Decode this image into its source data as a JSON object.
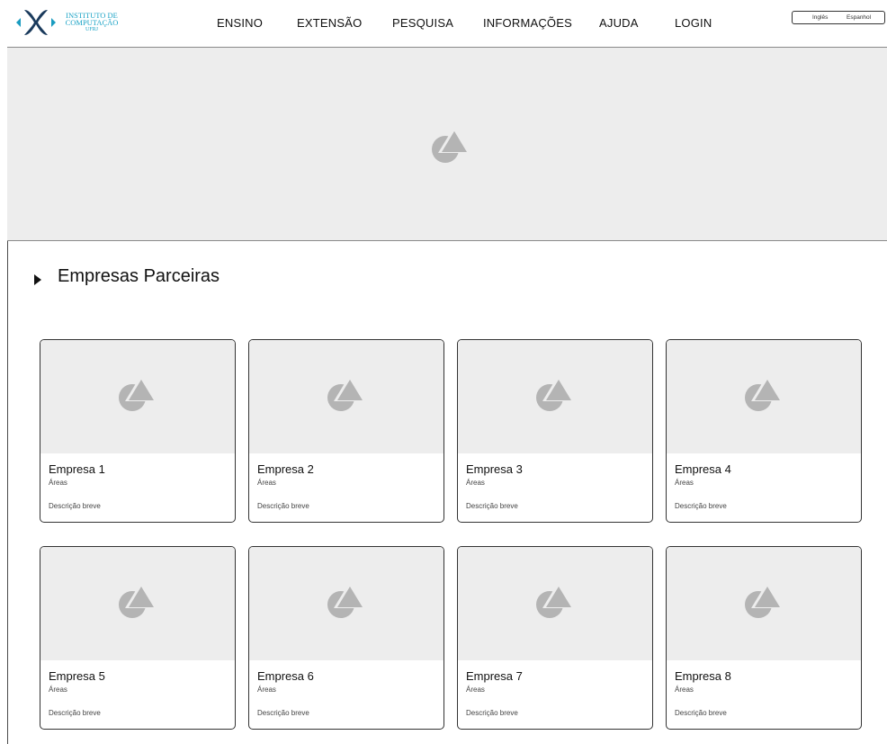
{
  "header": {
    "logo": {
      "line1": "INSTITUTO DE",
      "line2": "COMPUTAÇÃO",
      "line3": "UFRJ",
      "color": "#1ba3c6"
    },
    "nav": [
      {
        "label": "ENSINO"
      },
      {
        "label": "EXTENSÃO"
      },
      {
        "label": "PESQUISA"
      },
      {
        "label": "INFORMAÇÕES"
      },
      {
        "label": "AJUDA"
      },
      {
        "label": "LOGIN"
      }
    ],
    "lang": {
      "english": "Inglês",
      "spanish": "Espanhol"
    }
  },
  "hero": {
    "icon": "image-placeholder-icon"
  },
  "section": {
    "title": "Empresas Parceiras"
  },
  "cards": [
    {
      "name": "Empresa 1",
      "areas": "Áreas",
      "description": "Descrição breve"
    },
    {
      "name": "Empresa 2",
      "areas": "Áreas",
      "description": "Descrição breve"
    },
    {
      "name": "Empresa 3",
      "areas": "Áreas",
      "description": "Descrição breve"
    },
    {
      "name": "Empresa 4",
      "areas": "Áreas",
      "description": "Descrição breve"
    },
    {
      "name": "Empresa 5",
      "areas": "Áreas",
      "description": "Descrição breve"
    },
    {
      "name": "Empresa 6",
      "areas": "Áreas",
      "description": "Descrição breve"
    },
    {
      "name": "Empresa 7",
      "areas": "Áreas",
      "description": "Descrição breve"
    },
    {
      "name": "Empresa 8",
      "areas": "Áreas",
      "description": "Descrição breve"
    }
  ],
  "colors": {
    "placeholder_bg": "#ededed",
    "placeholder_icon": "#b4b4b4",
    "accent": "#1ba3c6"
  }
}
